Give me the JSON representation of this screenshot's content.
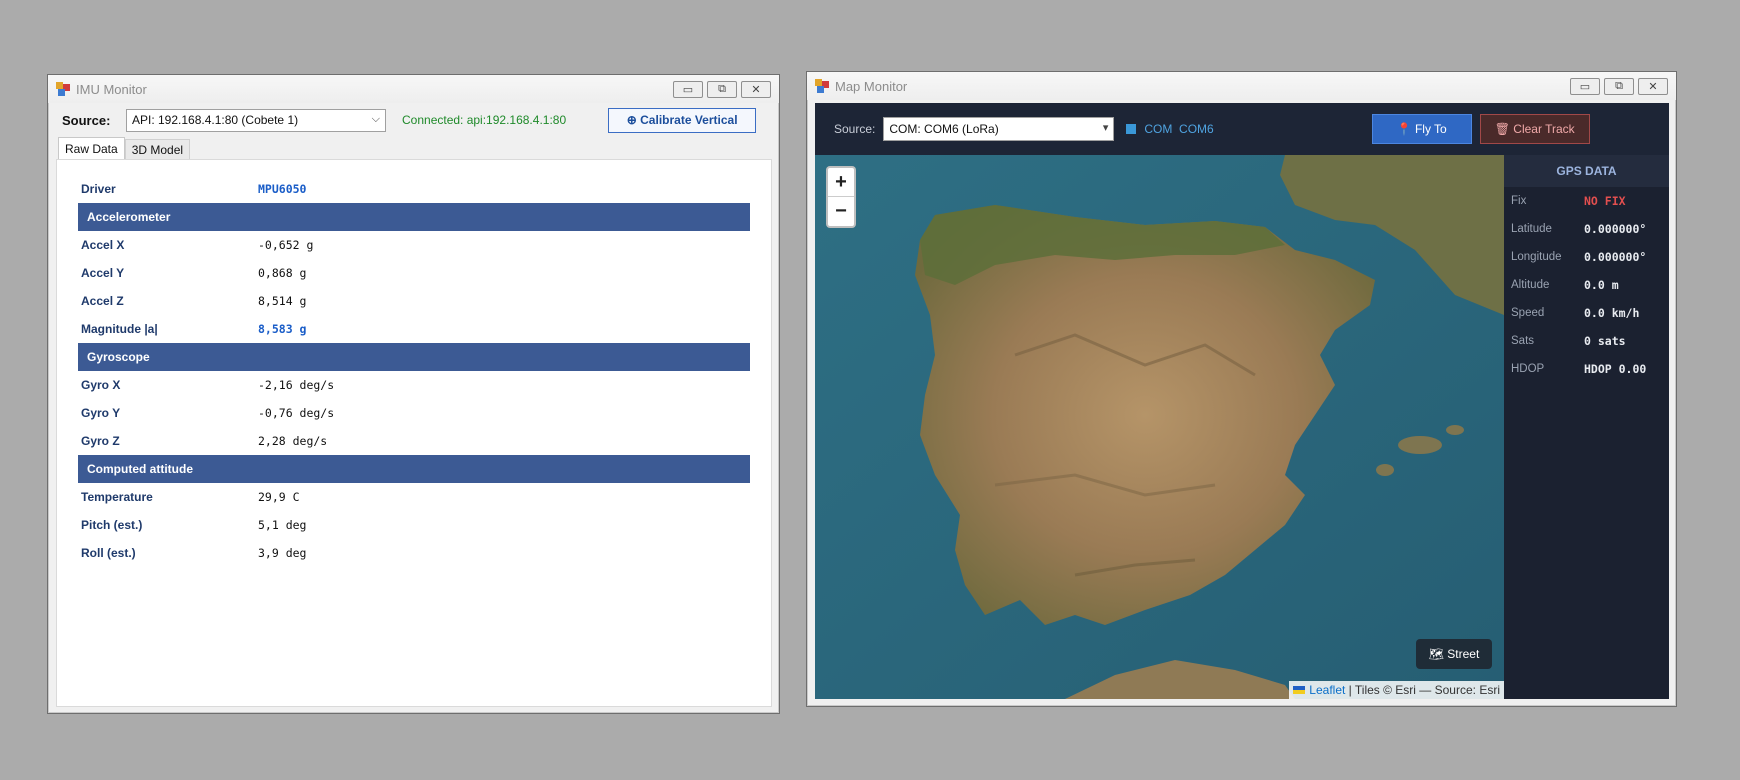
{
  "imu_window": {
    "title": "IMU Monitor",
    "source_label": "Source:",
    "source_value": "API: 192.168.4.1:80 (Cobete 1)",
    "connection_status": "Connected: api:192.168.4.1:80",
    "calibrate_label": "⊕ Calibrate Vertical",
    "tabs": [
      "Raw Data",
      "3D Model"
    ],
    "driver": {
      "label": "Driver",
      "value": "MPU6050"
    },
    "sections": {
      "accelerometer": "Accelerometer",
      "gyroscope": "Gyroscope",
      "computed": "Computed attitude"
    },
    "accel": [
      {
        "label": "Accel X",
        "value": "-0,652 g"
      },
      {
        "label": "Accel Y",
        "value": "0,868 g"
      },
      {
        "label": "Accel Z",
        "value": "8,514 g"
      },
      {
        "label": "Magnitude |a|",
        "value": "8,583 g"
      }
    ],
    "gyro": [
      {
        "label": "Gyro X",
        "value": "-2,16 deg/s"
      },
      {
        "label": "Gyro Y",
        "value": "-0,76 deg/s"
      },
      {
        "label": "Gyro Z",
        "value": "2,28 deg/s"
      }
    ],
    "computed": [
      {
        "label": "Temperature",
        "value": "29,9 C"
      },
      {
        "label": "Pitch (est.)",
        "value": "5,1 deg"
      },
      {
        "label": "Roll (est.)",
        "value": "3,9 deg"
      }
    ]
  },
  "map_window": {
    "title": "Map Monitor",
    "source_label": "Source:",
    "source_value": "COM: COM6 (LoRa)",
    "com_indicator": "COM  COM6",
    "fly_to_label": "📍 Fly To",
    "clear_track_label": "🗑 Clear Track",
    "zoom_in": "+",
    "zoom_out": "−",
    "street_label": "🗺 Street",
    "attribution_leaflet": "Leaflet",
    "attribution_rest": " | Tiles © Esri — Source: Esri",
    "gps": {
      "header": "GPS DATA",
      "rows": [
        {
          "label": "Fix",
          "value": "NO FIX"
        },
        {
          "label": "Latitude",
          "value": "0.000000°"
        },
        {
          "label": "Longitude",
          "value": "0.000000°"
        },
        {
          "label": "Altitude",
          "value": "0.0 m"
        },
        {
          "label": "Speed",
          "value": "0.0 km/h"
        },
        {
          "label": "Sats",
          "value": "0 sats"
        },
        {
          "label": "HDOP",
          "value": "HDOP 0.00"
        }
      ]
    }
  },
  "window_controls": {
    "minimize": "▭",
    "maximize": "⧉",
    "close": "✕"
  },
  "colors": {
    "section_header": "#3c5a94",
    "fix_status": "#e34f4f",
    "connected": "#1f8a2a",
    "fly_to": "#2f68c4"
  }
}
